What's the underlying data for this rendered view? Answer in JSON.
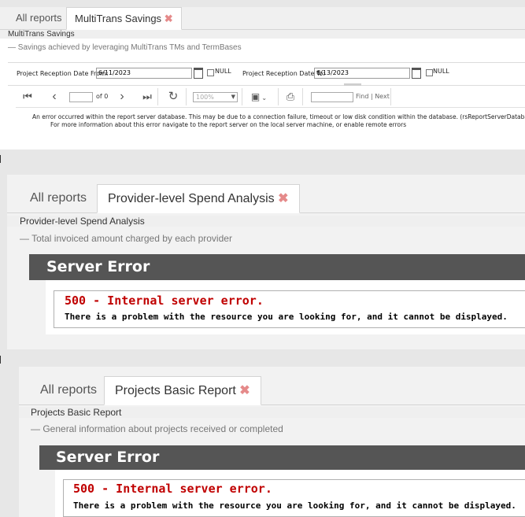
{
  "panel1": {
    "tabs": [
      {
        "label": "All reports"
      },
      {
        "label": "MultiTrans Savings",
        "close": "✖"
      }
    ],
    "report_title": "MultiTrans Savings",
    "report_desc": "— Savings achieved by leveraging MultiTrans TMs and TermBases",
    "params": {
      "from_label": "Project Reception Date From:",
      "from_value": "6/11/2023",
      "to_label": "Project Reception Date To:",
      "to_value": "6/13/2023",
      "null_label": "NULL"
    },
    "toolbar": {
      "page_of": "of 0",
      "zoom": "100%",
      "find_label": "Find",
      "find_sep": "|",
      "next_label": "Next"
    },
    "error_line1": "An error occurred within the report server database. This may be due to a connection failure, timeout or low disk condition within the database. (rsReportServerDatabaseError)",
    "error_line2": "For more information about this error navigate to the report server on the local server machine, or enable remote errors"
  },
  "panel2": {
    "tabs": [
      {
        "label": "All reports"
      },
      {
        "label": "Provider-level Spend Analysis",
        "close": "✖"
      }
    ],
    "report_title": "Provider-level Spend Analysis",
    "report_desc": "— Total invoiced amount charged by each provider",
    "server_error_title": "Server Error",
    "error_code": "500 - Internal server error.",
    "error_text": "There is a problem with the resource you are looking for, and it cannot be displayed."
  },
  "panel3": {
    "tabs": [
      {
        "label": "All reports"
      },
      {
        "label": "Projects Basic Report",
        "close": "✖"
      }
    ],
    "report_title": "Projects Basic Report",
    "report_desc": "— General information about projects received or completed",
    "server_error_title": "Server Error",
    "error_code": "500 - Internal server error.",
    "error_text": "There is a problem with the resource you are looking for, and it cannot be displayed."
  },
  "colors": {
    "error_red": "#c00000",
    "header_dark": "#555555",
    "close_x": "#e58a8a"
  }
}
